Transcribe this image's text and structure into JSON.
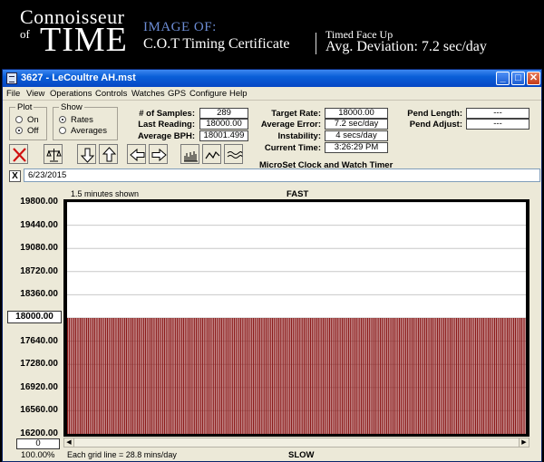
{
  "banner": {
    "brand_top": "Connoisseur",
    "brand_of": "of",
    "brand_main": "TIME",
    "image_of": "IMAGE OF:",
    "certificate": "C.O.T Timing Certificate",
    "position": "Timed Face Up",
    "avg_deviation": "Avg. Deviation: 7.2 sec/day"
  },
  "window": {
    "title": "3627 - LeCoultre AH.mst",
    "controls": {
      "minimize": "_",
      "maximize": "□",
      "close": "✕"
    }
  },
  "menu": [
    "File",
    "View",
    "Operations",
    "Controls",
    "Watches",
    "GPS",
    "Configure",
    "Help"
  ],
  "plot_group": {
    "title": "Plot",
    "options": [
      "On",
      "Off"
    ],
    "selected": "Off"
  },
  "show_group": {
    "title": "Show",
    "options": [
      "Rates",
      "Averages"
    ],
    "selected": "Rates"
  },
  "stats": {
    "samples_label": "# of Samples:",
    "samples": "289",
    "last_reading_label": "Last Reading:",
    "last_reading": "18000.00",
    "average_bph_label": "Average BPH:",
    "average_bph": "18001.499",
    "target_rate_label": "Target Rate:",
    "target_rate": "18000.00",
    "average_error_label": "Average Error:",
    "average_error": "7.2 sec/day",
    "instability_label": "Instability:",
    "instability": "4 secs/day",
    "current_time_label": "Current Time:",
    "current_time": "3:26:29 PM",
    "pend_length_label": "Pend Length:",
    "pend_length": "---",
    "pend_adjust_label": "Pend Adjust:",
    "pend_adjust": "---"
  },
  "app_name": "MicroSet Clock and Watch Timer",
  "toolbar": [
    {
      "name": "delete-button",
      "icon": "red-x-icon"
    },
    {
      "name": "balance-button",
      "icon": "balance-scale-icon"
    },
    {
      "name": "down-button",
      "icon": "arrow-down-icon"
    },
    {
      "name": "up-button",
      "icon": "arrow-up-icon"
    },
    {
      "name": "left-button",
      "icon": "arrow-left-icon"
    },
    {
      "name": "right-button",
      "icon": "arrow-right-icon"
    },
    {
      "name": "bars-button",
      "icon": "bar-graph-icon"
    },
    {
      "name": "line-button",
      "icon": "line-graph-icon"
    },
    {
      "name": "wave-button",
      "icon": "waveform-icon"
    }
  ],
  "date_close": "X",
  "date": "6/23/2015",
  "chart": {
    "shown_label": "1.5 minutes shown",
    "top_label": "FAST",
    "bottom_label": "SLOW",
    "grid_label": "Each grid line = 28.8 mins/day",
    "zoom": "100.00%",
    "offset": "0",
    "selected_tick": "18000.00",
    "fill_color": "#8b1a1a",
    "stripe_color": "#e0c8c8"
  },
  "chart_data": {
    "type": "bar",
    "y_ticks": [
      "19800.00",
      "19440.00",
      "19080.00",
      "18720.00",
      "18360.00",
      "18000.00",
      "17640.00",
      "17280.00",
      "16920.00",
      "16560.00",
      "16200.00"
    ],
    "ylim": [
      16200,
      19800
    ],
    "bar_count": 289,
    "value": 18000.0,
    "grid": true
  }
}
